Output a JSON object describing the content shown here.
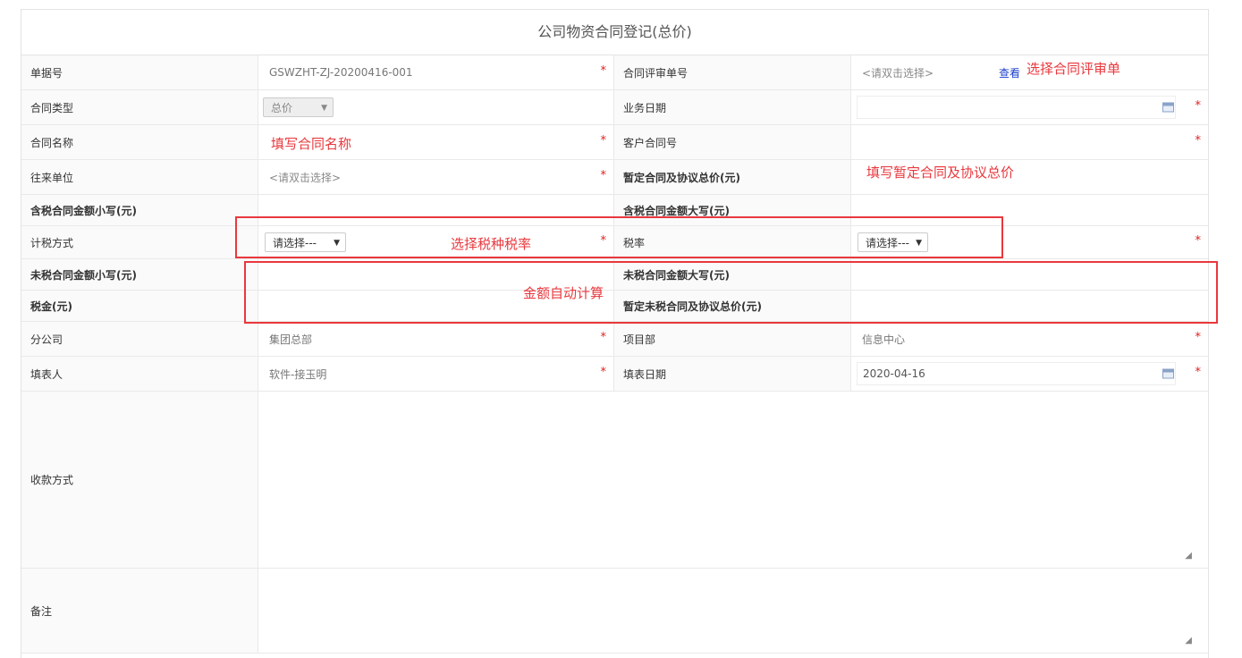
{
  "form": {
    "title": "公司物资合同登记(总价)",
    "rows": [
      {
        "label1": "单据号",
        "value1": "GSWZHT-ZJ-20200416-001",
        "label2": "合同评审单号",
        "value2_placeholder": "<请双击选择>",
        "link": "查看"
      },
      {
        "label1": "合同类型",
        "select1": "总价",
        "label2": "业务日期",
        "value2": ""
      },
      {
        "label1": "合同名称",
        "value1": "",
        "label2": "客户合同号",
        "value2": ""
      },
      {
        "label1": "往来单位",
        "value1_placeholder": "<请双击选择>",
        "label2": "暂定合同及协议总价(元)",
        "value2": ""
      },
      {
        "label1": "含税合同金额小写(元)",
        "value1": "",
        "label2": "含税合同金额大写(元)",
        "value2": ""
      },
      {
        "label1": "计税方式",
        "select1": "请选择---",
        "label2": "税率",
        "select2": "请选择---"
      },
      {
        "label1": "未税合同金额小写(元)",
        "value1": "",
        "label2": "未税合同金额大写(元)",
        "value2": ""
      },
      {
        "label1": "税金(元)",
        "value1": "",
        "label2": "暂定未税合同及协议总价(元)",
        "value2": ""
      },
      {
        "label1": "分公司",
        "value1": "集团总部",
        "label2": "项目部",
        "value2": "信息中心"
      },
      {
        "label1": "填表人",
        "value1": "软件-接玉明",
        "label2": "填表日期",
        "value2": "2020-04-16"
      },
      {
        "label1": "收款方式",
        "value1": ""
      },
      {
        "label1": "备注",
        "value1": ""
      }
    ],
    "required_mark": "*"
  },
  "annotations": {
    "select_review": "选择合同评审单",
    "fill_name": "填写合同名称",
    "fill_total": "填写暂定合同及协议总价",
    "select_tax": "选择税种税率",
    "auto_calc": "金额自动计算"
  },
  "colors": {
    "annotation": "#e8383d",
    "required": "#e02020",
    "link": "#1a3ecc"
  },
  "icons": {
    "calendar": "calendar-icon",
    "dropdown": "dropdown-arrow-icon",
    "resize": "resize-handle-icon"
  }
}
